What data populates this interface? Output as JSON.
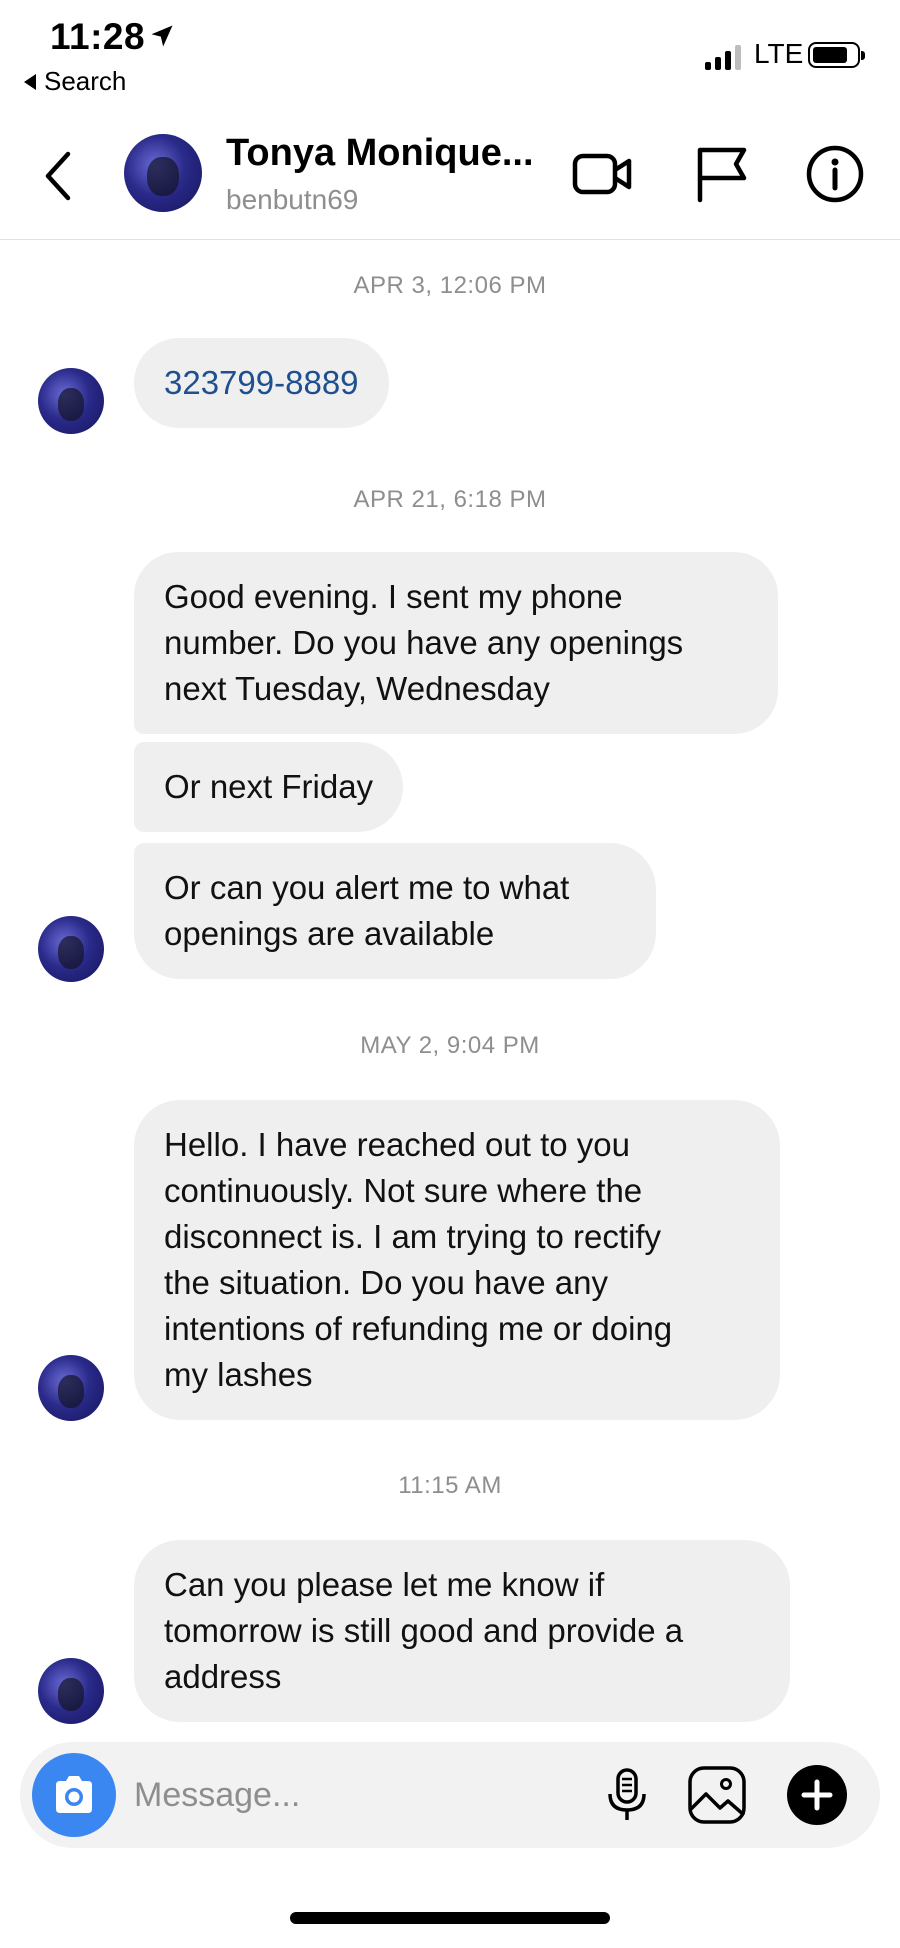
{
  "status_bar": {
    "time": "11:28",
    "back_label": "Search",
    "network": "LTE",
    "battery_level": 0.8
  },
  "header": {
    "name": "Tonya Monique...",
    "username": "benbutn69"
  },
  "messages": [
    {
      "timestamp": "APR 3, 12:06 PM"
    },
    {
      "text": "323799-8889"
    },
    {
      "timestamp": "APR 21, 6:18 PM"
    },
    {
      "lines": [
        "Good evening. I sent my phone",
        "number. Do you have any openings",
        "next Tuesday, Wednesday"
      ]
    },
    {
      "text": "Or next Friday"
    },
    {
      "lines": [
        "Or can you alert me to what",
        "openings are available"
      ]
    },
    {
      "timestamp": "MAY 2, 9:04 PM"
    },
    {
      "lines": [
        "Hello. I have reached out to you",
        "continuously. Not sure where the",
        "disconnect is. I am trying to rectify",
        "the situation. Do you have any",
        "intentions of refunding me or doing",
        "my lashes"
      ]
    },
    {
      "timestamp": "11:15 AM"
    },
    {
      "lines": [
        "Can you please let me know if",
        "tomorrow is still good and provide a",
        "address"
      ]
    }
  ],
  "composer": {
    "placeholder": "Message..."
  },
  "colors": {
    "bubble": "#efefef",
    "camera_button": "#3b87f2",
    "phone_link": "#1e4f8f",
    "muted_text": "#8e8e8e"
  },
  "icons": [
    "location-arrow-icon",
    "back-chevron-icon",
    "video-camera-icon",
    "flag-icon",
    "info-icon",
    "camera-icon",
    "microphone-icon",
    "gallery-icon",
    "plus-icon"
  ]
}
